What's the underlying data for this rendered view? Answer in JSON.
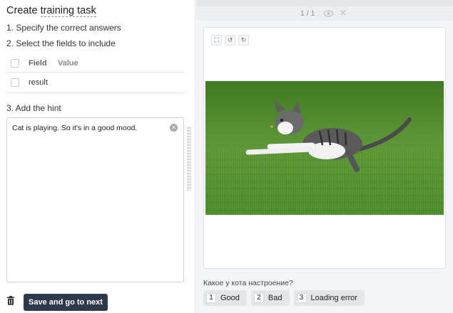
{
  "editor": {
    "title_prefix": "Create",
    "title_link": "training task",
    "step1": "1. Specify the correct answers",
    "step2": "2. Select the fields to include",
    "table_headers": {
      "field": "Field",
      "value": "Value"
    },
    "rows": [
      {
        "field": "result"
      }
    ],
    "step3": "3. Add the hint",
    "hint_text": "Cat is playing. So it's in a good mood.",
    "save_label": "Save and go to next"
  },
  "viewer": {
    "pager": "1 / 1",
    "question": "Какое у кота настроение?",
    "answers": [
      {
        "key": "1",
        "label": "Good"
      },
      {
        "key": "2",
        "label": "Bad"
      },
      {
        "key": "3",
        "label": "Loading error"
      }
    ]
  },
  "icons": {
    "fit": "fullscreen-icon",
    "rotate_left": "rotate-left-icon",
    "rotate_right": "rotate-right-icon",
    "visibility": "eye-icon",
    "close": "close-icon",
    "delete": "trash-icon",
    "clear": "clear-icon"
  },
  "colors": {
    "primary_button": "#2c3a4b",
    "panel_bg": "#f4f5f7",
    "grass": "#4f8a2a"
  }
}
